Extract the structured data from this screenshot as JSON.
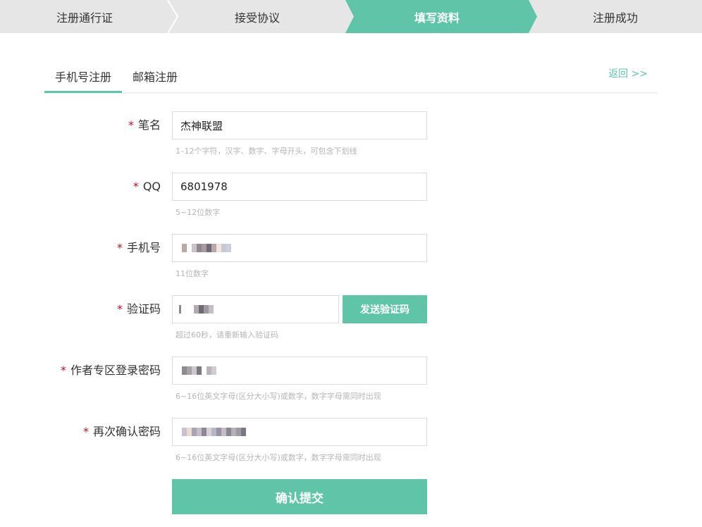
{
  "steps": [
    {
      "label": "注册通行证",
      "state": "done"
    },
    {
      "label": "接受协议",
      "state": "done"
    },
    {
      "label": "填写资料",
      "state": "active"
    },
    {
      "label": "注册成功",
      "state": "pending"
    }
  ],
  "tabs": {
    "phone_label": "手机号注册",
    "email_label": "邮箱注册",
    "active": "phone",
    "back_label": "返回 >>"
  },
  "form": {
    "required_mark": "*",
    "pen_name": {
      "label": "笔名",
      "value": "杰神联盟",
      "hint": "1–12个字符，汉字、数字、字母开头，可包含下划线"
    },
    "qq": {
      "label": "QQ",
      "value": "6801978",
      "hint": "5~12位数字"
    },
    "phone": {
      "label": "手机号",
      "value": "",
      "hint": "11位数字"
    },
    "code": {
      "label": "验证码",
      "value": "",
      "hint": "超过60秒，请重新输入验证码",
      "send_label": "发送验证码"
    },
    "password": {
      "label": "作者专区登录密码",
      "value": "",
      "hint": "6~16位英文字母(区分大小写)或数字，数字字母需同时出现"
    },
    "confirm_password": {
      "label": "再次确认密码",
      "value": "",
      "hint": "6~16位英文字母(区分大小写)或数字，数字字母需同时出现"
    },
    "submit_label": "确认提交"
  },
  "colors": {
    "accent": "#5fc4a8",
    "required": "#b0152a",
    "step_bg": "#e6e6e6"
  }
}
